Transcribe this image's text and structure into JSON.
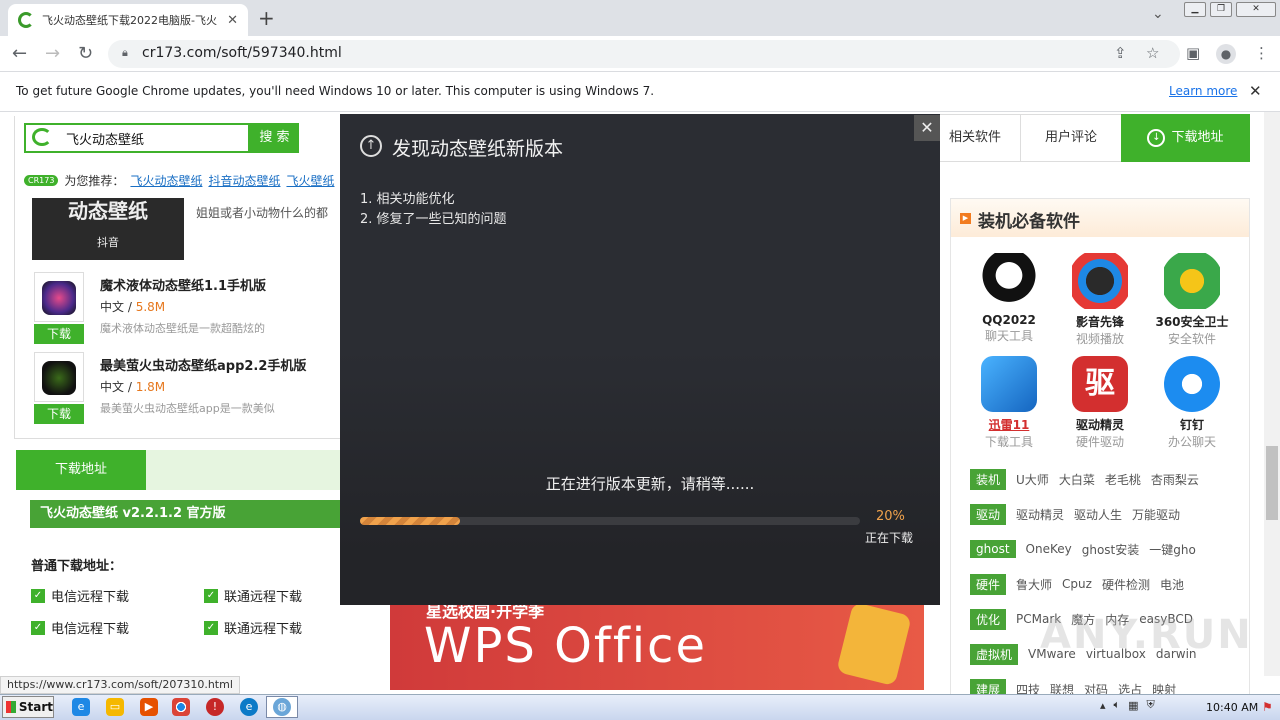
{
  "browser": {
    "tab_title": "飞火动态壁纸下载2022电脑版-飞火",
    "url": "cr173.com/soft/597340.html",
    "infobar_text": "To get future Google Chrome updates, you'll need Windows 10 or later. This computer is using Windows 7.",
    "learn_more": "Learn more",
    "status_url": "https://www.cr173.com/soft/207310.html"
  },
  "site": {
    "search_value": "飞火动态壁纸",
    "search_button": "搜 索",
    "recommend_badge": "CR173",
    "recommend_label": "为您推荐：",
    "recommend_links": [
      "飞火动态壁纸",
      "抖音动态壁纸",
      "飞火壁纸"
    ],
    "thumb_text": "动态壁纸",
    "thumb_sub": "抖音",
    "truncated_desc": "姐姐或者小动物什么的都",
    "apps": [
      {
        "title": "魔术液体动态壁纸1.1手机版",
        "lang": "中文 / ",
        "size": "5.8M",
        "desc": "魔术液体动态壁纸是一款超酷炫的",
        "download": "下载"
      },
      {
        "title": "最美萤火虫动态壁纸app2.2手机版",
        "lang": "中文 / ",
        "size": "1.8M",
        "desc": "最美萤火虫动态壁纸app是一款美似",
        "download": "下载"
      }
    ],
    "download_tab": "下载地址",
    "version_bar": "飞火动态壁纸 v2.2.1.2 官方版",
    "normal_download": "普通下载地址：",
    "links": [
      "电信远程下载",
      "联通远程下载",
      "电信远程下载",
      "联通远程下载"
    ],
    "ad": {
      "small": "星选校园·开学季",
      "big": "WPS Office"
    },
    "nav_tabs": [
      "相关软件",
      "用户评论",
      "下载地址"
    ],
    "essentials_title": "装机必备软件",
    "essentials": [
      {
        "name": "QQ2022",
        "cat": "聊天工具",
        "color": "#222"
      },
      {
        "name": "影音先锋",
        "cat": "视频播放",
        "color": "#d9251d"
      },
      {
        "name": "360安全卫士",
        "cat": "安全软件",
        "color": "#3aa84a"
      },
      {
        "name": "迅雷11",
        "cat": "下载工具",
        "color": "#1e88e5"
      },
      {
        "name": "驱动精灵",
        "cat": "硬件驱动",
        "color": "#d32f2f"
      },
      {
        "name": "钉钉",
        "cat": "办公聊天",
        "color": "#1c8cf0"
      }
    ],
    "categories": [
      {
        "tag": "装机",
        "items": [
          "U大师",
          "大白菜",
          "老毛桃",
          "杏雨梨云"
        ]
      },
      {
        "tag": "驱动",
        "items": [
          "驱动精灵",
          "驱动人生",
          "万能驱动"
        ]
      },
      {
        "tag": "ghost",
        "items": [
          "OneKey",
          "ghost安装",
          "一键ghо"
        ]
      },
      {
        "tag": "硬件",
        "items": [
          "鲁大师",
          "Cpuz",
          "硬件检测",
          "电池"
        ]
      },
      {
        "tag": "优化",
        "items": [
          "PCMark",
          "魔方",
          "内存",
          "easyBCD"
        ]
      },
      {
        "tag": "虚拟机",
        "items": [
          "VMware",
          "virtualbox",
          "darwin"
        ]
      },
      {
        "tag": "建展",
        "items": [
          "四技",
          "联想",
          "对码",
          "选占",
          "映射"
        ]
      }
    ]
  },
  "dialog": {
    "title": "发现动态壁纸新版本",
    "notes": [
      "1. 相关功能优化",
      "2. 修复了一些已知的问题"
    ],
    "message": "正在进行版本更新，请稍等......",
    "progress": 0.2,
    "percent_text": "20%",
    "status": "正在下载"
  },
  "watermark": "ANY.RUN",
  "taskbar": {
    "start": "Start",
    "clock": "10:40 AM"
  }
}
